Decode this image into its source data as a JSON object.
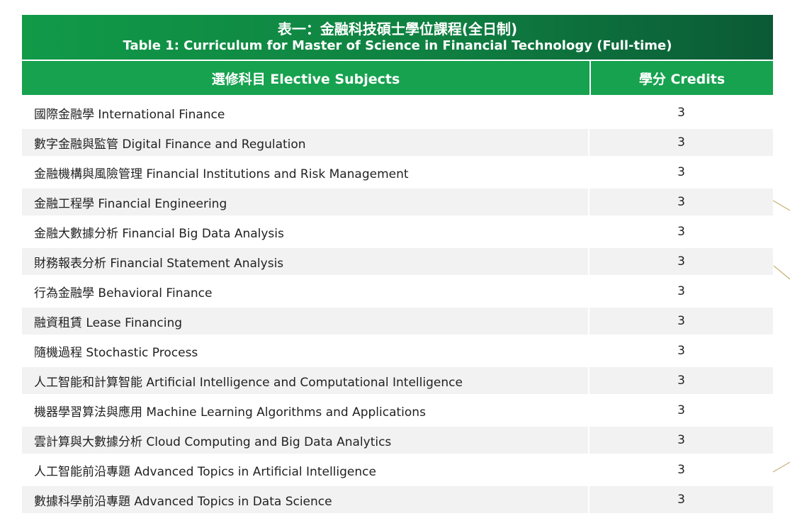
{
  "title": {
    "zh": "表一：金融科技碩士學位課程(全日制)",
    "en": "Table 1: Curriculum for Master of Science in Financial Technology (Full-time)"
  },
  "header": {
    "subject": "選修科目 Elective Subjects",
    "credits": "學分 Credits"
  },
  "rows": [
    {
      "subject": "國際金融學 International Finance",
      "credits": "3"
    },
    {
      "subject": "數字金融與監管 Digital Finance and Regulation",
      "credits": "3"
    },
    {
      "subject": "金融機構與風險管理 Financial Institutions and Risk Management",
      "credits": "3"
    },
    {
      "subject": "金融工程學 Financial Engineering",
      "credits": "3"
    },
    {
      "subject": "金融大數據分析 Financial Big Data Analysis",
      "credits": "3"
    },
    {
      "subject": "財務報表分析 Financial Statement Analysis",
      "credits": "3"
    },
    {
      "subject": "行為金融學 Behavioral Finance",
      "credits": "3"
    },
    {
      "subject": "融資租賃 Lease Financing",
      "credits": "3"
    },
    {
      "subject": "隨機過程 Stochastic Process",
      "credits": "3"
    },
    {
      "subject": "人工智能和計算智能 Artificial Intelligence and Computational Intelligence",
      "credits": "3"
    },
    {
      "subject": "機器學習算法與應用 Machine Learning Algorithms and Applications",
      "credits": "3"
    },
    {
      "subject": "雲計算與大數據分析 Cloud Computing and Big Data Analytics",
      "credits": "3"
    },
    {
      "subject": "人工智能前沿專題 Advanced Topics in Artificial Intelligence",
      "credits": "3"
    },
    {
      "subject": "數據科學前沿專題 Advanced Topics in Data Science",
      "credits": "3"
    }
  ],
  "colors": {
    "title_bar_start": "#119a48",
    "title_bar_end": "#0b5a36",
    "header_bg": "#17a24f",
    "alt_row_bg": "#f2f2f2",
    "decor_line": "#c8b27a"
  }
}
